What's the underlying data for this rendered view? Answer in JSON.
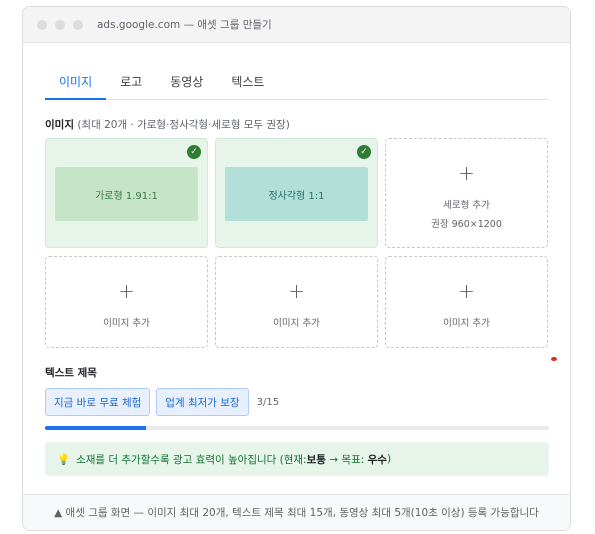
{
  "window": {
    "title": "ads.google.com — 애셋 그룹 만들기"
  },
  "tabs": [
    {
      "label": "이미지",
      "active": true
    },
    {
      "label": "로고",
      "active": false
    },
    {
      "label": "동영상",
      "active": false
    },
    {
      "label": "텍스트",
      "active": false
    }
  ],
  "images": {
    "label_bold": "이미지",
    "label_note": "(최대 20개 · 가로형·정사각형·세로형 모두 권장)",
    "cells": [
      {
        "type": "filled",
        "thumb_label": "가로형 1.91:1",
        "check": "✓"
      },
      {
        "type": "filled",
        "thumb_label": "정사각형 1:1",
        "check": "✓"
      },
      {
        "type": "empty",
        "plus": "+",
        "label": "세로형 추가",
        "sub": "권장 960×1200"
      },
      {
        "type": "empty",
        "plus": "+",
        "label": "이미지 추가"
      },
      {
        "type": "empty",
        "plus": "+",
        "label": "이미지 추가"
      },
      {
        "type": "empty",
        "plus": "+",
        "label": "이미지 추가"
      }
    ]
  },
  "text_titles": {
    "label": "텍스트 제목",
    "chips": [
      "지금 바로 무료 체험",
      "업계 최저가 보장"
    ],
    "counter": "3/15",
    "progress": 0.2
  },
  "tip": {
    "icon": "lightbulb-icon",
    "glyph": "💡",
    "text_prefix": "소재를 더 추가할수록 광고 효력이 높아집니다 (현재: ",
    "current": "보통",
    "arrow": " → 목표: ",
    "target": "우수",
    "suffix": ")"
  },
  "footer": {
    "text": "▲ 애셋 그룹 화면 — 이미지 최대 20개, 텍스트 제목 최대 15개, 동영상 최대 5개(10초 이상) 등록 가능합니다"
  },
  "colors": {
    "accent": "#1a73e8",
    "success": "#2e7d32",
    "tip_bg": "#e6f4ea"
  }
}
